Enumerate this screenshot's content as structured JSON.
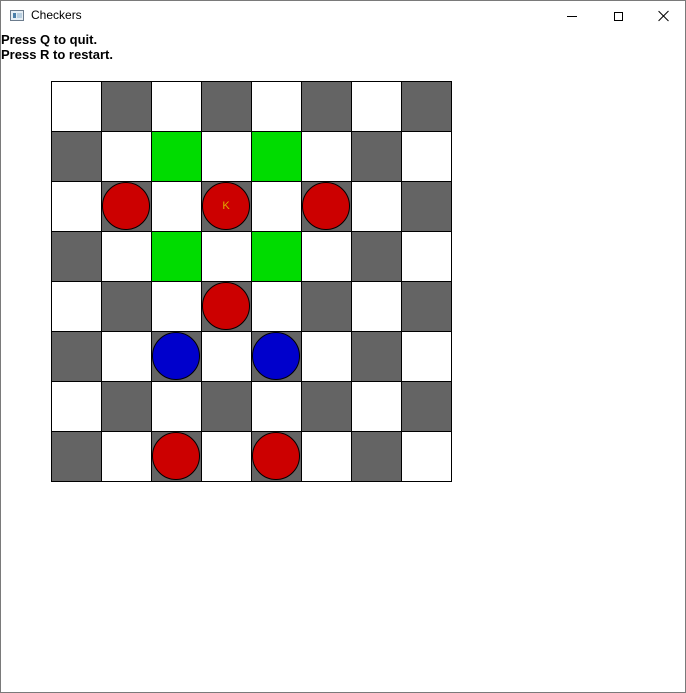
{
  "window": {
    "title": "Checkers",
    "controls": [
      "minimize",
      "maximize",
      "close"
    ]
  },
  "instructions": {
    "line1": "Press Q to quit.",
    "line2": "Press R to restart."
  },
  "colors": {
    "light_square": "#ffffff",
    "dark_square": "#646464",
    "highlight_square": "#00dc00",
    "red_piece": "#cc0000",
    "blue_piece": "#0000cc",
    "king_label": "#e0a800"
  },
  "board": {
    "rows": 8,
    "cols": 8,
    "highlights": [
      [
        1,
        2
      ],
      [
        1,
        4
      ],
      [
        3,
        2
      ],
      [
        3,
        4
      ]
    ],
    "pieces": [
      {
        "row": 2,
        "col": 1,
        "color": "red",
        "king": false
      },
      {
        "row": 2,
        "col": 3,
        "color": "red",
        "king": true
      },
      {
        "row": 2,
        "col": 5,
        "color": "red",
        "king": false
      },
      {
        "row": 4,
        "col": 3,
        "color": "red",
        "king": false
      },
      {
        "row": 5,
        "col": 2,
        "color": "blue",
        "king": false
      },
      {
        "row": 5,
        "col": 4,
        "color": "blue",
        "king": false
      },
      {
        "row": 7,
        "col": 2,
        "color": "red",
        "king": false
      },
      {
        "row": 7,
        "col": 4,
        "color": "red",
        "king": false
      }
    ],
    "king_text": "K"
  }
}
